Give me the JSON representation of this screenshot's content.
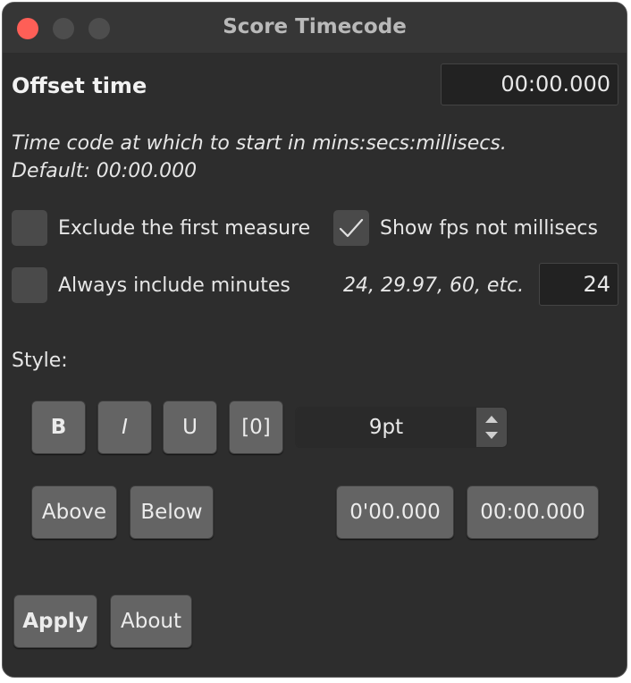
{
  "window": {
    "title": "Score Timecode"
  },
  "offset": {
    "label": "Offset time",
    "value": "00:00.000"
  },
  "help": {
    "line1": "Time code at which to start in mins:secs:millisecs.",
    "line2": "Default: 00:00.000"
  },
  "options": {
    "exclude_first": {
      "label": "Exclude the first measure",
      "checked": false
    },
    "show_fps": {
      "label": "Show fps not millisecs",
      "checked": true
    },
    "always_minutes": {
      "label": "Always include minutes",
      "checked": false
    },
    "fps_hint": "24, 29.97, 60, etc.",
    "fps_value": "24"
  },
  "style": {
    "label": "Style:",
    "bold": "B",
    "italic": "I",
    "underline": "U",
    "brackets": "[0]",
    "size": "9pt"
  },
  "placement": {
    "above": "Above",
    "below": "Below"
  },
  "formats": {
    "short": "0'00.000",
    "long": "00:00.000"
  },
  "footer": {
    "apply": "Apply",
    "about": "About"
  }
}
